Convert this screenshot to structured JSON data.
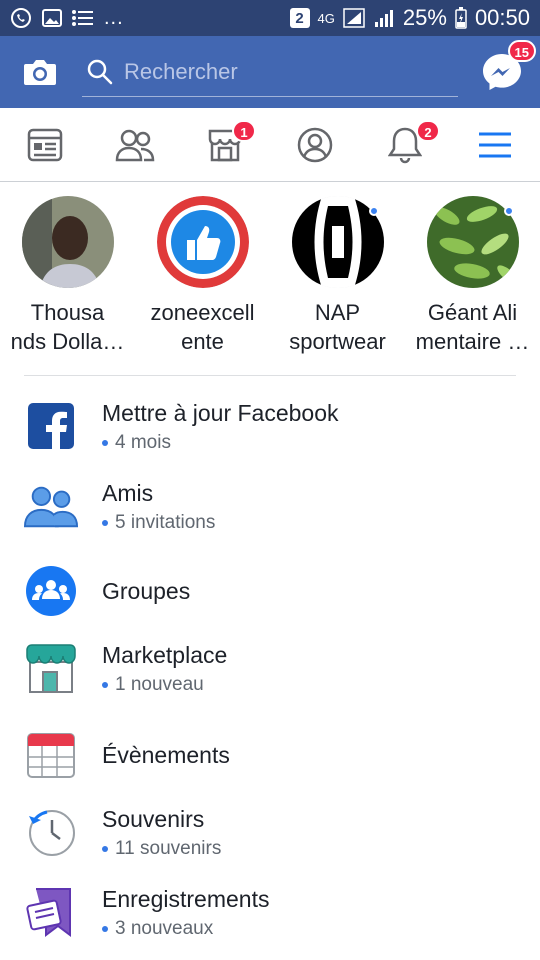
{
  "status_bar": {
    "notification_count": "2",
    "network": "4G",
    "battery": "25%",
    "time": "00:50",
    "dots": "..."
  },
  "header": {
    "search_placeholder": "Rechercher",
    "messenger_badge": "15"
  },
  "tabs": [
    {
      "name": "news-feed",
      "badge": ""
    },
    {
      "name": "friends",
      "badge": ""
    },
    {
      "name": "marketplace",
      "badge": "1"
    },
    {
      "name": "profile",
      "badge": ""
    },
    {
      "name": "notifications",
      "badge": "2"
    },
    {
      "name": "menu",
      "badge": ""
    }
  ],
  "stories": [
    {
      "name_line1": "Thousa",
      "name_line2": "nds Dolla…"
    },
    {
      "name_line1": "zoneexcell",
      "name_line2": "ente"
    },
    {
      "name_line1": "NAP",
      "name_line2": "sportwear"
    },
    {
      "name_line1": "Géant Ali",
      "name_line2": "mentaire …"
    }
  ],
  "menu": [
    {
      "title": "Mettre à jour Facebook",
      "subtitle": "4 mois"
    },
    {
      "title": "Amis",
      "subtitle": "5 invitations"
    },
    {
      "title": "Groupes",
      "subtitle": ""
    },
    {
      "title": "Marketplace",
      "subtitle": "1 nouveau"
    },
    {
      "title": "Évènements",
      "subtitle": ""
    },
    {
      "title": "Souvenirs",
      "subtitle": "11 souvenirs"
    },
    {
      "title": "Enregistrements",
      "subtitle": "3 nouveaux"
    }
  ],
  "colors": {
    "status_bar": "#2d4373",
    "header": "#4267b2",
    "accent": "#3578e5",
    "badge": "#f02849"
  }
}
